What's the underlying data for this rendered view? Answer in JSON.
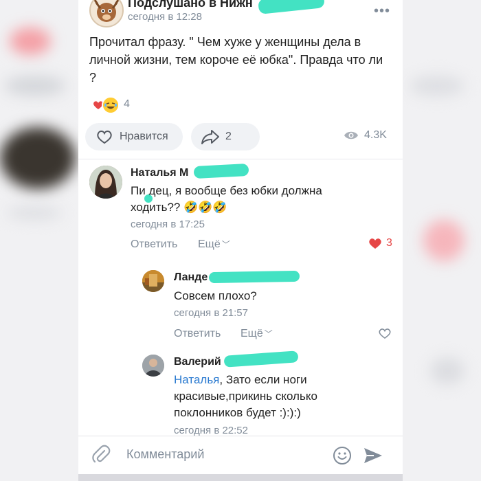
{
  "post": {
    "group_name": "Подслушано в Нижн",
    "time": "сегодня в 12:28",
    "text": "Прочитал фразу. \" Чем хуже у женщины дела в личной жизни, тем короче её юбка\". Правда что ли ?",
    "reactions_count": "4",
    "like_label": "Нравится",
    "share_count": "2",
    "views_count": "4.3K"
  },
  "comments": [
    {
      "author": "Наталья М",
      "text": "Пи  дец, я вообще без юбки должна ходить?? 🤣🤣🤣",
      "time": "сегодня в 17:25",
      "reply_label": "Ответить",
      "more_label": "Ещё",
      "likes": "3"
    },
    {
      "author": "Ланде",
      "text": "Совсем плохо?",
      "time": "сегодня в 21:57",
      "reply_label": "Ответить",
      "more_label": "Ещё"
    },
    {
      "author": "Валерий",
      "mention": "Наталья",
      "text": ", Зато если ноги красивые,прикинь сколько поклонников будет :):):)",
      "time": "сегодня в 22:52"
    }
  ],
  "composer": {
    "placeholder": "Комментарий"
  },
  "colors": {
    "accent": "#2a7ad0",
    "like_red": "#e64646",
    "scribble": "#39e0c0"
  },
  "icons": [
    "more-icon",
    "heart-icon",
    "laugh-emoji-icon",
    "share-icon",
    "eye-icon",
    "attach-icon",
    "smile-icon",
    "send-icon",
    "chevron-down-icon"
  ]
}
